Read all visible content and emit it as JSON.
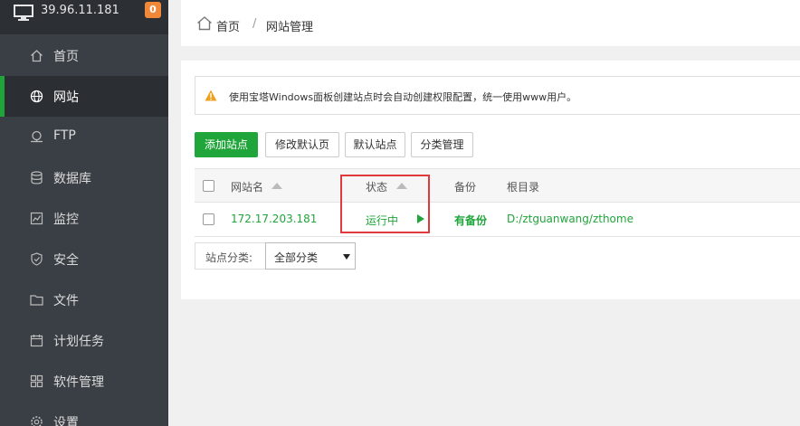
{
  "header": {
    "ip": "39.96.11.181",
    "badge": "0"
  },
  "sidebar": {
    "items": [
      {
        "label": "首页",
        "icon": "home-icon"
      },
      {
        "label": "网站",
        "icon": "globe-icon",
        "active": true
      },
      {
        "label": "FTP",
        "icon": "ftp-icon"
      },
      {
        "label": "数据库",
        "icon": "database-icon"
      },
      {
        "label": "监控",
        "icon": "monitor-chart-icon"
      },
      {
        "label": "安全",
        "icon": "shield-icon"
      },
      {
        "label": "文件",
        "icon": "folder-icon"
      },
      {
        "label": "计划任务",
        "icon": "calendar-icon"
      },
      {
        "label": "软件管理",
        "icon": "grid-icon"
      },
      {
        "label": "设置",
        "icon": "gear-icon"
      }
    ]
  },
  "breadcrumb": {
    "home": "首页",
    "separator": "/",
    "current": "网站管理"
  },
  "alert": {
    "text": "使用宝塔Windows面板创建站点时会自动创建权限配置，统一使用www用户。"
  },
  "toolbar": {
    "add_site": "添加站点",
    "edit_default": "修改默认页",
    "default_site": "默认站点",
    "category_manage": "分类管理"
  },
  "table": {
    "columns": [
      "网站名",
      "状态",
      "备份",
      "根目录"
    ],
    "rows": [
      {
        "name": "172.17.203.181",
        "status": "运行中",
        "backup": "有备份",
        "root": "D:/ztguanwang/zthome"
      }
    ]
  },
  "category": {
    "label": "站点分类:",
    "selected": "全部分类"
  },
  "colors": {
    "accent": "#20a53a",
    "sidebar_bg": "#3a3f45",
    "badge": "#f0883a",
    "highlight": "#e0393e"
  }
}
